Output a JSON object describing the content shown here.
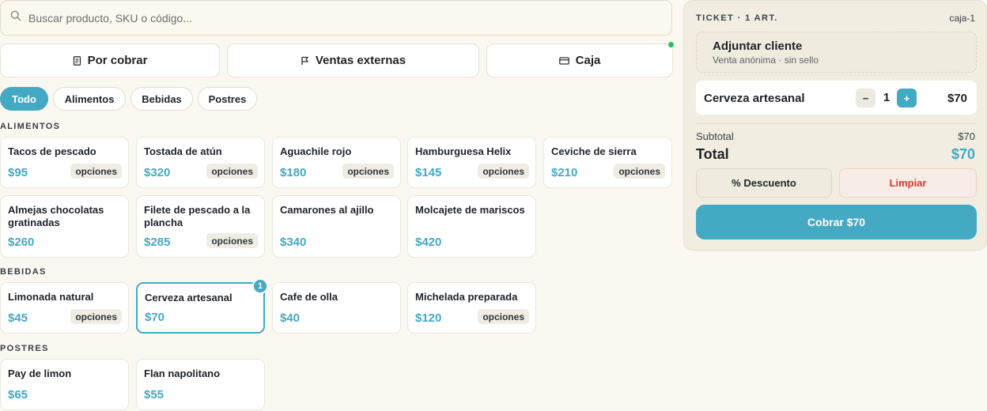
{
  "search": {
    "placeholder": "Buscar producto, SKU o código..."
  },
  "modes": [
    {
      "label": "Por cobrar",
      "icon": "receipt-icon"
    },
    {
      "label": "Ventas externas",
      "icon": "flag-icon"
    },
    {
      "label": "Caja",
      "icon": "credit-card-icon"
    }
  ],
  "categories": [
    "Todo",
    "Alimentos",
    "Bebidas",
    "Postres"
  ],
  "sections": {
    "alimentos": {
      "label": "ALIMENTOS",
      "items": [
        {
          "name": "Tacos de pescado",
          "price": "$95",
          "options": "opciones"
        },
        {
          "name": "Tostada de atún",
          "price": "$320",
          "options": "opciones"
        },
        {
          "name": "Aguachile rojo",
          "price": "$180",
          "options": "opciones"
        },
        {
          "name": "Hamburguesa Helix",
          "price": "$145",
          "options": "opciones"
        },
        {
          "name": "Ceviche de sierra",
          "price": "$210",
          "options": "opciones"
        },
        {
          "name": "Almejas chocolatas gratinadas",
          "price": "$260"
        },
        {
          "name": "Filete de pescado a la plancha",
          "price": "$285",
          "options": "opciones"
        },
        {
          "name": "Camarones al ajillo",
          "price": "$340"
        },
        {
          "name": "Molcajete de mariscos",
          "price": "$420"
        }
      ]
    },
    "bebidas": {
      "label": "BEBIDAS",
      "items": [
        {
          "name": "Limonada natural",
          "price": "$45",
          "options": "opciones"
        },
        {
          "name": "Cerveza artesanal",
          "price": "$70",
          "badge": "1"
        },
        {
          "name": "Cafe de olla",
          "price": "$40"
        },
        {
          "name": "Michelada preparada",
          "price": "$120",
          "options": "opciones"
        }
      ]
    },
    "postres": {
      "label": "POSTRES",
      "items": [
        {
          "name": "Pay de limon",
          "price": "$65"
        },
        {
          "name": "Flan napolitano",
          "price": "$55"
        }
      ]
    }
  },
  "ticket": {
    "title": "TICKET · 1 ART.",
    "register": "caja-1",
    "client_title": "Adjuntar cliente",
    "client_subtitle": "Venta anónima · sin sello",
    "lines": [
      {
        "name": "Cerveza artesanal",
        "qty": "1",
        "price": "$70",
        "minus": "−",
        "plus": "+"
      }
    ],
    "subtotal_label": "Subtotal",
    "subtotal_value": "$70",
    "total_label": "Total",
    "total_value": "$70",
    "discount_label": "% Descuento",
    "clear_label": "Limpiar",
    "charge_label": "Cobrar $70"
  },
  "colors": {
    "accent": "#44a9c3",
    "background": "#faf8f1",
    "danger": "#d73a2e",
    "online": "#22c55e"
  }
}
